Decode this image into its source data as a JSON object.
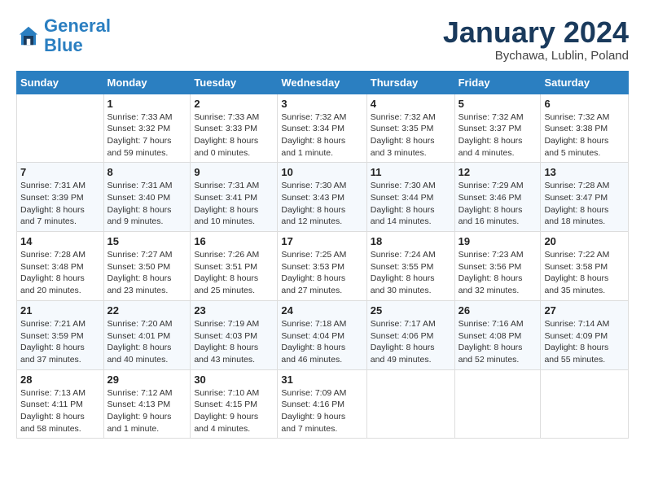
{
  "header": {
    "logo_line1": "General",
    "logo_line2": "Blue",
    "month_title": "January 2024",
    "location": "Bychawa, Lublin, Poland"
  },
  "weekdays": [
    "Sunday",
    "Monday",
    "Tuesday",
    "Wednesday",
    "Thursday",
    "Friday",
    "Saturday"
  ],
  "weeks": [
    [
      {
        "day": "",
        "details": ""
      },
      {
        "day": "1",
        "details": "Sunrise: 7:33 AM\nSunset: 3:32 PM\nDaylight: 7 hours\nand 59 minutes."
      },
      {
        "day": "2",
        "details": "Sunrise: 7:33 AM\nSunset: 3:33 PM\nDaylight: 8 hours\nand 0 minutes."
      },
      {
        "day": "3",
        "details": "Sunrise: 7:32 AM\nSunset: 3:34 PM\nDaylight: 8 hours\nand 1 minute."
      },
      {
        "day": "4",
        "details": "Sunrise: 7:32 AM\nSunset: 3:35 PM\nDaylight: 8 hours\nand 3 minutes."
      },
      {
        "day": "5",
        "details": "Sunrise: 7:32 AM\nSunset: 3:37 PM\nDaylight: 8 hours\nand 4 minutes."
      },
      {
        "day": "6",
        "details": "Sunrise: 7:32 AM\nSunset: 3:38 PM\nDaylight: 8 hours\nand 5 minutes."
      }
    ],
    [
      {
        "day": "7",
        "details": "Sunrise: 7:31 AM\nSunset: 3:39 PM\nDaylight: 8 hours\nand 7 minutes."
      },
      {
        "day": "8",
        "details": "Sunrise: 7:31 AM\nSunset: 3:40 PM\nDaylight: 8 hours\nand 9 minutes."
      },
      {
        "day": "9",
        "details": "Sunrise: 7:31 AM\nSunset: 3:41 PM\nDaylight: 8 hours\nand 10 minutes."
      },
      {
        "day": "10",
        "details": "Sunrise: 7:30 AM\nSunset: 3:43 PM\nDaylight: 8 hours\nand 12 minutes."
      },
      {
        "day": "11",
        "details": "Sunrise: 7:30 AM\nSunset: 3:44 PM\nDaylight: 8 hours\nand 14 minutes."
      },
      {
        "day": "12",
        "details": "Sunrise: 7:29 AM\nSunset: 3:46 PM\nDaylight: 8 hours\nand 16 minutes."
      },
      {
        "day": "13",
        "details": "Sunrise: 7:28 AM\nSunset: 3:47 PM\nDaylight: 8 hours\nand 18 minutes."
      }
    ],
    [
      {
        "day": "14",
        "details": "Sunrise: 7:28 AM\nSunset: 3:48 PM\nDaylight: 8 hours\nand 20 minutes."
      },
      {
        "day": "15",
        "details": "Sunrise: 7:27 AM\nSunset: 3:50 PM\nDaylight: 8 hours\nand 23 minutes."
      },
      {
        "day": "16",
        "details": "Sunrise: 7:26 AM\nSunset: 3:51 PM\nDaylight: 8 hours\nand 25 minutes."
      },
      {
        "day": "17",
        "details": "Sunrise: 7:25 AM\nSunset: 3:53 PM\nDaylight: 8 hours\nand 27 minutes."
      },
      {
        "day": "18",
        "details": "Sunrise: 7:24 AM\nSunset: 3:55 PM\nDaylight: 8 hours\nand 30 minutes."
      },
      {
        "day": "19",
        "details": "Sunrise: 7:23 AM\nSunset: 3:56 PM\nDaylight: 8 hours\nand 32 minutes."
      },
      {
        "day": "20",
        "details": "Sunrise: 7:22 AM\nSunset: 3:58 PM\nDaylight: 8 hours\nand 35 minutes."
      }
    ],
    [
      {
        "day": "21",
        "details": "Sunrise: 7:21 AM\nSunset: 3:59 PM\nDaylight: 8 hours\nand 37 minutes."
      },
      {
        "day": "22",
        "details": "Sunrise: 7:20 AM\nSunset: 4:01 PM\nDaylight: 8 hours\nand 40 minutes."
      },
      {
        "day": "23",
        "details": "Sunrise: 7:19 AM\nSunset: 4:03 PM\nDaylight: 8 hours\nand 43 minutes."
      },
      {
        "day": "24",
        "details": "Sunrise: 7:18 AM\nSunset: 4:04 PM\nDaylight: 8 hours\nand 46 minutes."
      },
      {
        "day": "25",
        "details": "Sunrise: 7:17 AM\nSunset: 4:06 PM\nDaylight: 8 hours\nand 49 minutes."
      },
      {
        "day": "26",
        "details": "Sunrise: 7:16 AM\nSunset: 4:08 PM\nDaylight: 8 hours\nand 52 minutes."
      },
      {
        "day": "27",
        "details": "Sunrise: 7:14 AM\nSunset: 4:09 PM\nDaylight: 8 hours\nand 55 minutes."
      }
    ],
    [
      {
        "day": "28",
        "details": "Sunrise: 7:13 AM\nSunset: 4:11 PM\nDaylight: 8 hours\nand 58 minutes."
      },
      {
        "day": "29",
        "details": "Sunrise: 7:12 AM\nSunset: 4:13 PM\nDaylight: 9 hours\nand 1 minute."
      },
      {
        "day": "30",
        "details": "Sunrise: 7:10 AM\nSunset: 4:15 PM\nDaylight: 9 hours\nand 4 minutes."
      },
      {
        "day": "31",
        "details": "Sunrise: 7:09 AM\nSunset: 4:16 PM\nDaylight: 9 hours\nand 7 minutes."
      },
      {
        "day": "",
        "details": ""
      },
      {
        "day": "",
        "details": ""
      },
      {
        "day": "",
        "details": ""
      }
    ]
  ]
}
